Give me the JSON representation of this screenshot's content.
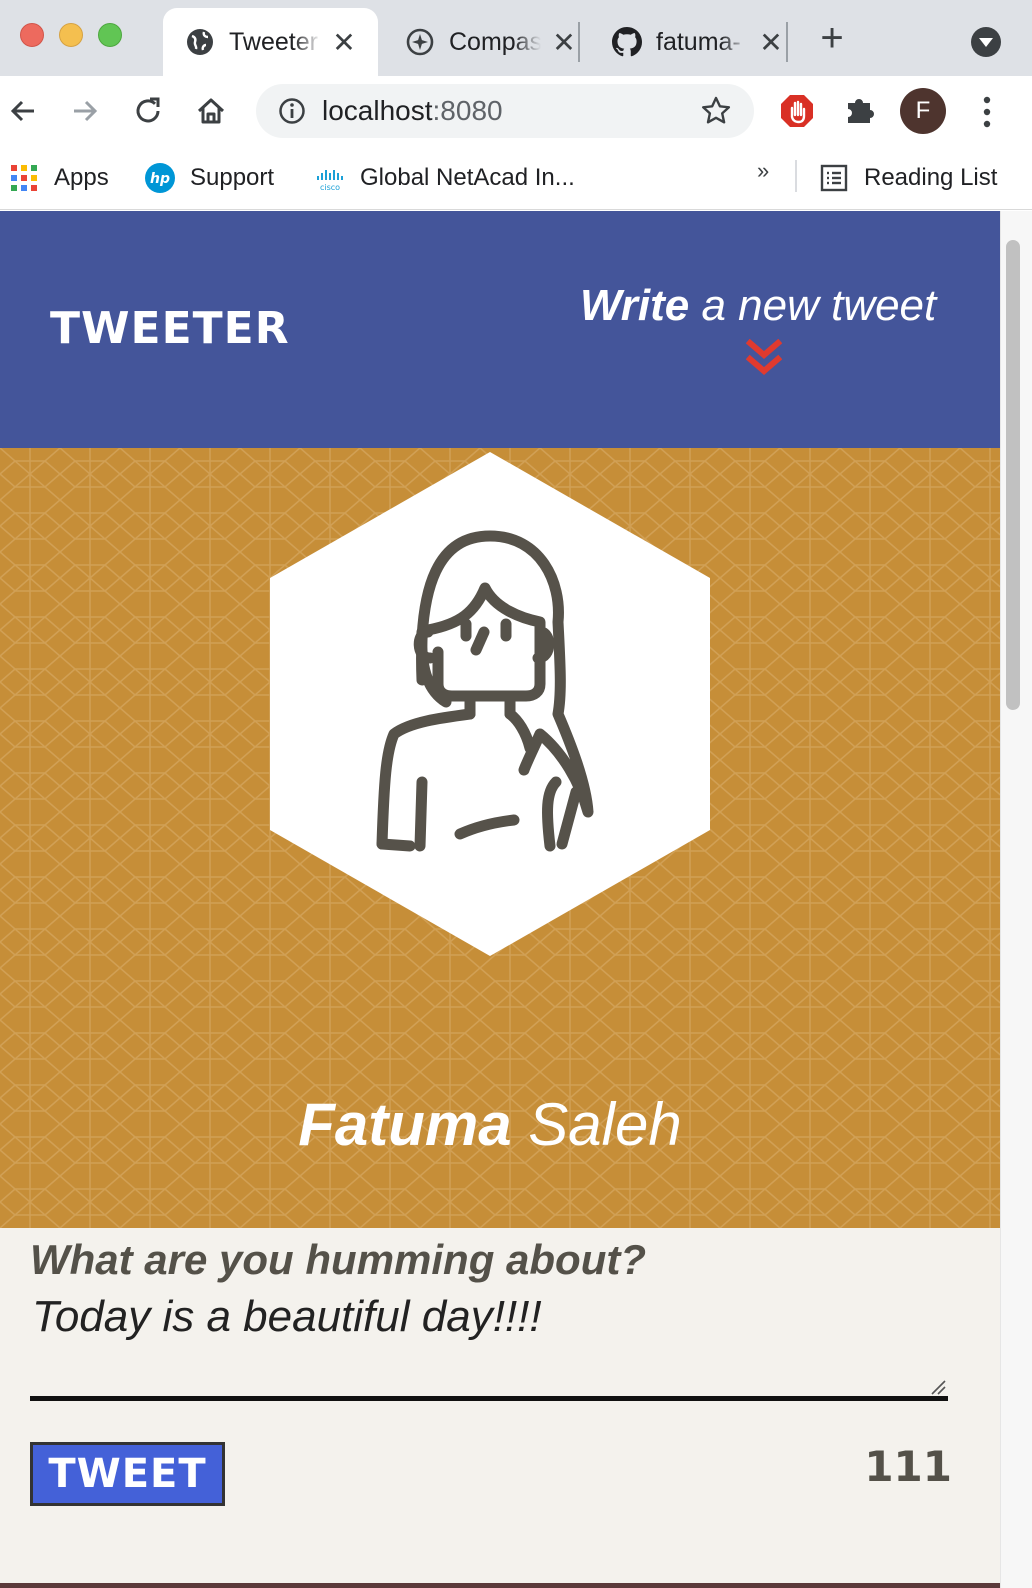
{
  "browser": {
    "tabs": [
      {
        "title": "Tweeter",
        "active": true,
        "icon": "globe-icon"
      },
      {
        "title": "Compass",
        "active": false,
        "icon": "compass-icon"
      },
      {
        "title": "fatuma-",
        "active": false,
        "icon": "github-icon"
      }
    ],
    "close_glyph": "✕",
    "new_tab_glyph": "+",
    "address": {
      "host": "localhost",
      "port": ":8080"
    },
    "profile_initial": "F",
    "bookmarks": [
      {
        "label": "Apps",
        "icon": "apps-grid-icon"
      },
      {
        "label": "Support",
        "icon": "hp-icon"
      },
      {
        "label": "Global NetAcad In...",
        "icon": "cisco-icon"
      }
    ],
    "bookmarks_more": "»",
    "reading_list": "Reading List"
  },
  "header": {
    "brand": "TWEETER",
    "write_bold": "Write",
    "write_rest": "a new tweet"
  },
  "profile": {
    "first_name": "Fatuma",
    "last_name": "Saleh"
  },
  "composer": {
    "prompt": "What are you humming about?",
    "text": "Today is a beautiful day!!!!",
    "button_label": "TWEET",
    "counter": "111"
  },
  "colors": {
    "header_bg": "#44559a",
    "profile_bg": "#c68e38",
    "page_bg": "#f4f2ed",
    "button_bg": "#4461d8",
    "chevron": "#e03a2f"
  }
}
